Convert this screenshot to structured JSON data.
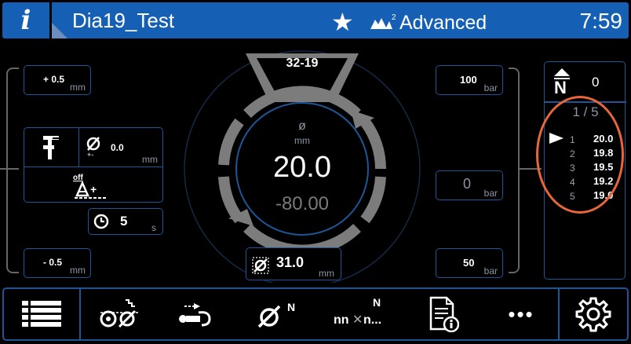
{
  "header": {
    "info_icon": "i",
    "title": "Dia19_Test",
    "favorite_icon": "star-icon",
    "mode_icon": "users-level-icon",
    "mode_superscript": "2",
    "mode_label": "Advanced",
    "time": "7:59"
  },
  "left_panel": {
    "upper_tol": "+ 0.5",
    "upper_tol_unit": "mm",
    "dia_offset": "0.0",
    "dia_offset_unit": "mm",
    "auto_label": "off",
    "timer_value": "5",
    "timer_unit": "s",
    "lower_tol": "- 0.5",
    "lower_tol_unit": "mm"
  },
  "gauge": {
    "program": "32-19",
    "symbol": "ø",
    "unit": "mm",
    "value": "20.0",
    "secondary": "-80.00",
    "bottom_value": "31.0",
    "bottom_unit": "mm"
  },
  "pressure": {
    "top": "100",
    "top_unit": "bar",
    "mid": "0",
    "mid_unit": "bar",
    "bottom": "50",
    "bottom_unit": "bar"
  },
  "right_panel": {
    "count_label": "N",
    "count_value": "0",
    "page": "1 / 5",
    "items": [
      {
        "idx": "1",
        "val": "20.0"
      },
      {
        "idx": "2",
        "val": "19.8"
      },
      {
        "idx": "3",
        "val": "19.5"
      },
      {
        "idx": "4",
        "val": "19.2"
      },
      {
        "idx": "5",
        "val": "19.0"
      }
    ]
  },
  "toolbar": {
    "btn_n_sup": "N",
    "btn_nn_sup": "N",
    "btn_nn_text": "nn",
    "btn_nn_text2": "n...",
    "more": "•••"
  },
  "colors": {
    "accent": "#1560b5",
    "border": "#1e5596",
    "highlight": "#e8663a"
  }
}
